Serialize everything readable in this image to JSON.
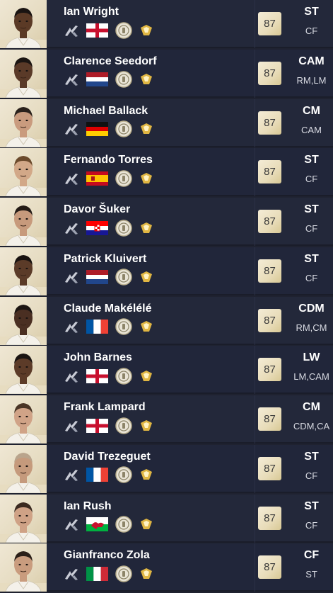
{
  "players": [
    {
      "name": "Ian Wright",
      "rating": "87",
      "position": "ST",
      "alt_positions": "CF",
      "nation": "England",
      "nation_icon": "flag-england",
      "skin": "#5b3a26",
      "hair": "#1a1412"
    },
    {
      "name": "Clarence Seedorf",
      "rating": "87",
      "position": "CAM",
      "alt_positions": "RM,LM",
      "nation": "Netherlands",
      "nation_icon": "flag-netherlands",
      "skin": "#5a3a28",
      "hair": "#1b1512"
    },
    {
      "name": "Michael Ballack",
      "rating": "87",
      "position": "CM",
      "alt_positions": "CAM",
      "nation": "Germany",
      "nation_icon": "flag-germany",
      "skin": "#c99b7e",
      "hair": "#2a211c"
    },
    {
      "name": "Fernando Torres",
      "rating": "87",
      "position": "ST",
      "alt_positions": "CF",
      "nation": "Spain",
      "nation_icon": "flag-spain",
      "skin": "#d2a888",
      "hair": "#6b4a2c"
    },
    {
      "name": "Davor Šuker",
      "rating": "87",
      "position": "ST",
      "alt_positions": "CF",
      "nation": "Croatia",
      "nation_icon": "flag-croatia",
      "skin": "#c79a7c",
      "hair": "#241b16"
    },
    {
      "name": "Patrick Kluivert",
      "rating": "87",
      "position": "ST",
      "alt_positions": "CF",
      "nation": "Netherlands",
      "nation_icon": "flag-netherlands",
      "skin": "#5b3b28",
      "hair": "#181210"
    },
    {
      "name": "Claude Makélélé",
      "rating": "87",
      "position": "CDM",
      "alt_positions": "RM,CM",
      "nation": "France",
      "nation_icon": "flag-france",
      "skin": "#4a2f22",
      "hair": "#1c1512"
    },
    {
      "name": "John Barnes",
      "rating": "87",
      "position": "LW",
      "alt_positions": "LM,CAM",
      "nation": "England",
      "nation_icon": "flag-england",
      "skin": "#5c3b28",
      "hair": "#1a1412"
    },
    {
      "name": "Frank Lampard",
      "rating": "87",
      "position": "CM",
      "alt_positions": "CDM,CA",
      "nation": "England",
      "nation_icon": "flag-england",
      "skin": "#d0a387",
      "hair": "#4a3526"
    },
    {
      "name": "David Trezeguet",
      "rating": "87",
      "position": "ST",
      "alt_positions": "CF",
      "nation": "France",
      "nation_icon": "flag-france",
      "skin": "#c59a7c",
      "hair": "#b9a48c"
    },
    {
      "name": "Ian Rush",
      "rating": "87",
      "position": "ST",
      "alt_positions": "CF",
      "nation": "Wales",
      "nation_icon": "flag-wales",
      "skin": "#cfa286",
      "hair": "#3b2a20"
    },
    {
      "name": "Gianfranco Zola",
      "rating": "87",
      "position": "CF",
      "alt_positions": "ST",
      "nation": "Italy",
      "nation_icon": "flag-italy",
      "skin": "#c99c7e",
      "hair": "#2b1f18"
    }
  ],
  "icons": {
    "workrate": "workrate-icon",
    "club": "icons-club-badge",
    "league": "icons-league-badge"
  },
  "colors": {
    "row_bg": "#23283a",
    "page_bg": "#1f2230",
    "rating_bg": "#ede3c5",
    "text": "#ffffff",
    "card_gold": "#d6b45a"
  }
}
